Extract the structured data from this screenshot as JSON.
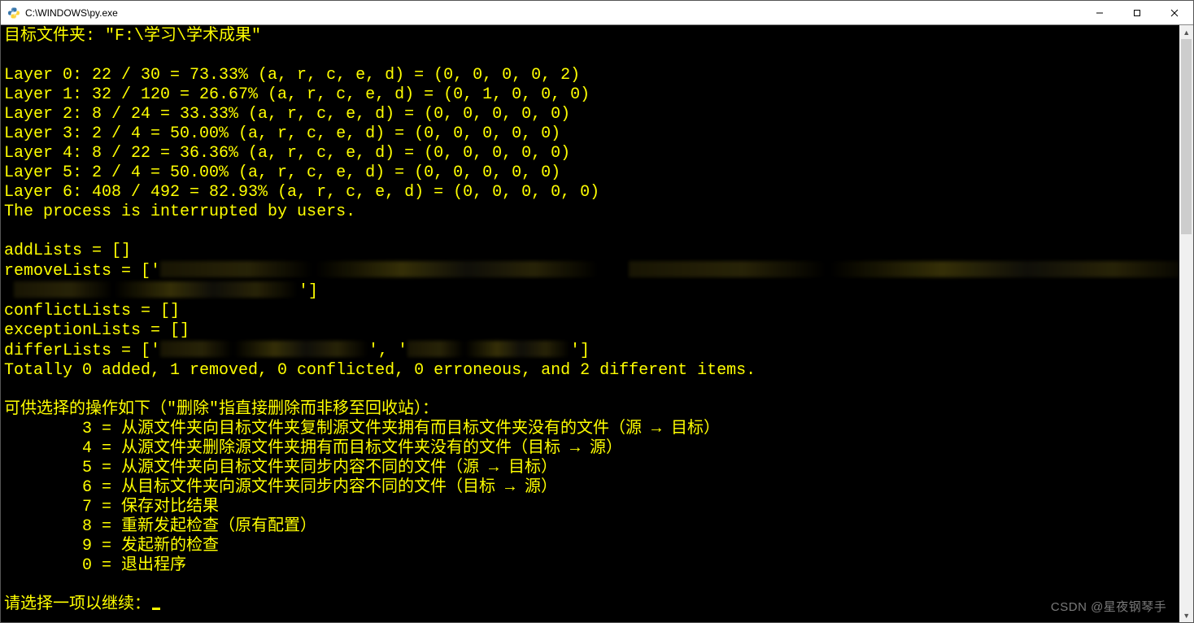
{
  "window": {
    "title": "C:\\WINDOWS\\py.exe"
  },
  "terminal": {
    "header": "目标文件夹: \"F:\\学习\\学术成果\"",
    "layers": [
      "Layer 0: 22 / 30 = 73.33% (a, r, c, e, d) = (0, 0, 0, 0, 2)",
      "Layer 1: 32 / 120 = 26.67% (a, r, c, e, d) = (0, 1, 0, 0, 0)",
      "Layer 2: 8 / 24 = 33.33% (a, r, c, e, d) = (0, 0, 0, 0, 0)",
      "Layer 3: 2 / 4 = 50.00% (a, r, c, e, d) = (0, 0, 0, 0, 0)",
      "Layer 4: 8 / 22 = 36.36% (a, r, c, e, d) = (0, 0, 0, 0, 0)",
      "Layer 5: 2 / 4 = 50.00% (a, r, c, e, d) = (0, 0, 0, 0, 0)",
      "Layer 6: 408 / 492 = 82.93% (a, r, c, e, d) = (0, 0, 0, 0, 0)"
    ],
    "interrupted": "The process is interrupted by users.",
    "addLists": "addLists = []",
    "removeLists_pre": "removeLists = ['",
    "removeLists_tail": "']",
    "conflictLists": "conflictLists = []",
    "exceptionLists": "exceptionLists = []",
    "differLists_pre": "differLists = ['",
    "differ_sep": "', '",
    "differ_tail": "']",
    "summary": "Totally 0 added, 1 removed, 0 conflicted, 0 erroneous, and 2 different items.",
    "menu_title": "可供选择的操作如下（\"删除\"指直接删除而非移至回收站）：",
    "menu": [
      "        3 = 从源文件夹向目标文件夹复制源文件夹拥有而目标文件夹没有的文件（源 → 目标）",
      "        4 = 从源文件夹删除源文件夹拥有而目标文件夹没有的文件（目标 → 源）",
      "        5 = 从源文件夹向目标文件夹同步内容不同的文件（源 → 目标）",
      "        6 = 从目标文件夹向源文件夹同步内容不同的文件（目标 → 源）",
      "        7 = 保存对比结果",
      "        8 = 重新发起检查（原有配置）",
      "        9 = 发起新的检查",
      "        0 = 退出程序"
    ],
    "prompt": "请选择一项以继续："
  },
  "watermark": "CSDN @星夜钢琴手"
}
